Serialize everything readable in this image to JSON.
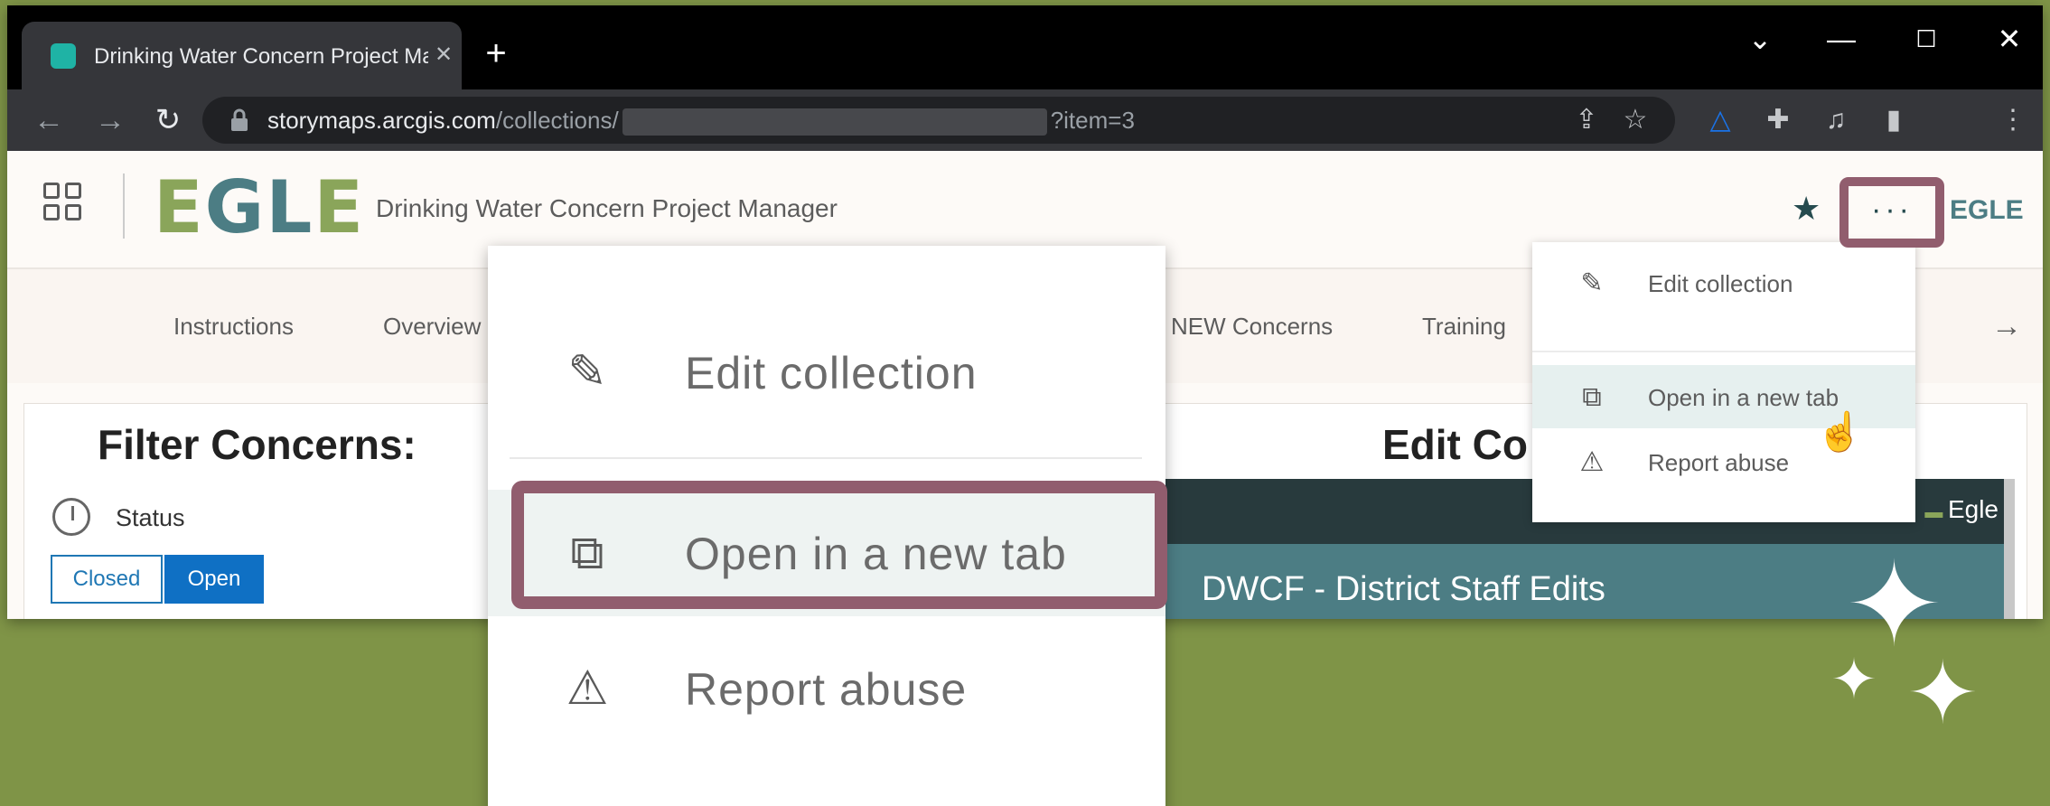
{
  "browser": {
    "tab_title": "Drinking Water Concern Project Manager",
    "new_tab_label": "+",
    "url_host": "storymaps.arcgis.com",
    "url_path": "/collections/",
    "url_query": "?item=3"
  },
  "header": {
    "logo_letters": [
      "E",
      "G",
      "L",
      "E"
    ],
    "site_title": "Drinking Water Concern Project Manager",
    "more_label": "···",
    "logo_right": "EGLE"
  },
  "nav": {
    "items": [
      "Instructions",
      "Overview",
      "NEW Concerns",
      "Training"
    ],
    "next_arrow": "→"
  },
  "filter": {
    "title": "Filter Concerns:",
    "status_label": "Status",
    "closed_label": "Closed",
    "open_label": "Open"
  },
  "edit": {
    "title": "Edit Co",
    "embed_logo_text": "Egle",
    "embed_title": "DWCF - District Staff Edits"
  },
  "menu": {
    "items": [
      {
        "label": "Edit collection",
        "icon": "pencil-icon"
      },
      {
        "label": "Open in a new tab",
        "icon": "open-external-icon"
      },
      {
        "label": "Report abuse",
        "icon": "warning-icon"
      }
    ],
    "highlight_color": "#e6f0ef"
  },
  "colors": {
    "background": "#7f9447",
    "annotation": "#915d6e",
    "brand_teal": "#4c7d84",
    "brand_green": "#8aa55a"
  }
}
